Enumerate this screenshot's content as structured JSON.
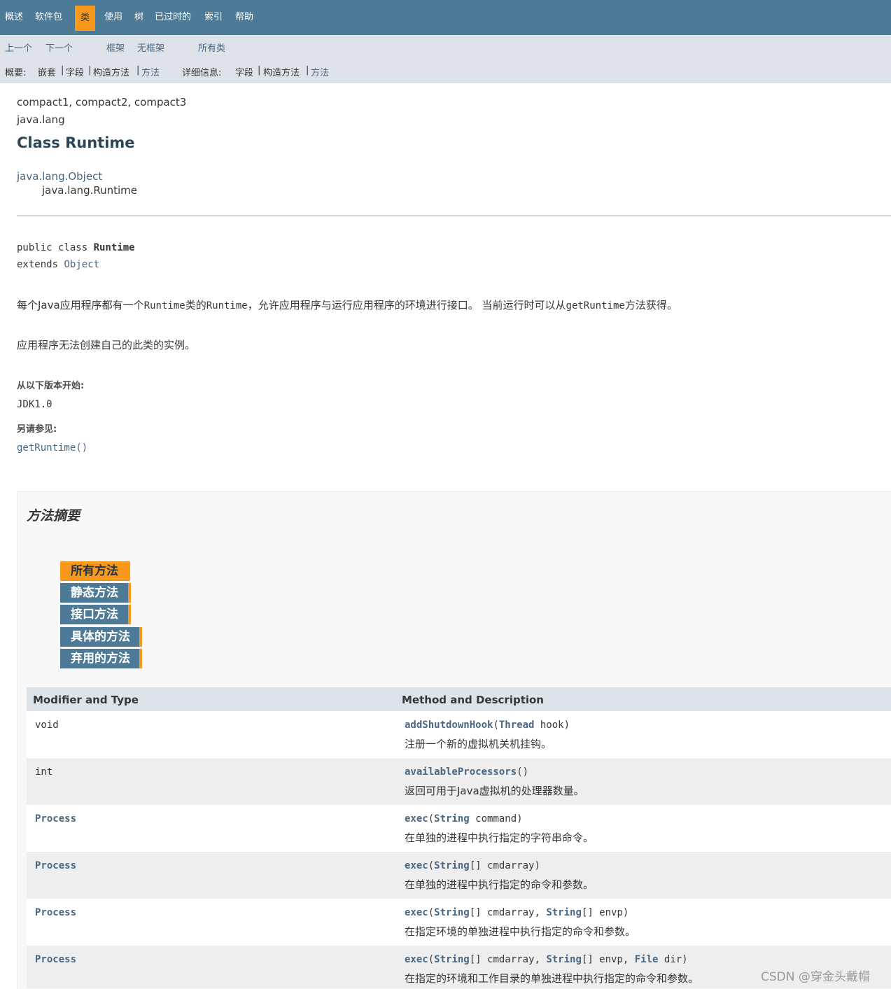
{
  "topnav": {
    "overview": "概述",
    "package": "软件包",
    "class": "类",
    "use": "使用",
    "tree": "树",
    "deprecated": "已过时的",
    "index": "索引",
    "help": "帮助"
  },
  "subnav": {
    "prev": "上一个",
    "next": "下一个",
    "frames": "框架",
    "no_frames": "无框架",
    "all_classes": "所有类",
    "summary_label": "概要:",
    "summary_nested": "嵌套",
    "summary_field": "字段",
    "summary_constr": "构造方法",
    "summary_method": "方法",
    "detail_label": "详细信息:",
    "detail_field": "字段",
    "detail_constr": "构造方法",
    "detail_method": "方法",
    "sep": "|"
  },
  "header": {
    "profiles": "compact1, compact2, compact3",
    "package": "java.lang",
    "title": "Class Runtime"
  },
  "inheritance": {
    "parent": "java.lang.Object",
    "child": "java.lang.Runtime"
  },
  "signature": {
    "line1_prefix": "public class ",
    "line1_name": "Runtime",
    "line2_prefix": "extends ",
    "line2_link": "Object"
  },
  "description": {
    "p1_a": "每个Java应用程序都有一个",
    "p1_code1": "Runtime",
    "p1_b": "类的",
    "p1_code2": "Runtime",
    "p1_c": "，允许应用程序与运行应用程序的环境进行接口。 当前运行时可以从",
    "p1_code3": "getRuntime",
    "p1_d": "方法获得。",
    "p2": "应用程序无法创建自己的此类的实例。"
  },
  "since": {
    "label": "从以下版本开始:",
    "value": "JDK1.0"
  },
  "see_also": {
    "label": "另请参见:",
    "value": "getRuntime()"
  },
  "method_summary": {
    "title": "方法摘要",
    "tabs": [
      "所有方法",
      "静态方法",
      "接口方法",
      "具体的方法",
      "弃用的方法"
    ],
    "col_type": "Modifier and Type",
    "col_method": "Method and Description",
    "rows": [
      {
        "type": "void",
        "name": "addShutdownHook",
        "open": "(",
        "p1_type": "Thread",
        "p1_rest": " hook)",
        "desc": "注册一个新的虚拟机关机挂钩。"
      },
      {
        "type": "int",
        "name": "availableProcessors",
        "open": "()",
        "desc": "返回可用于Java虚拟机的处理器数量。"
      },
      {
        "type": "Process",
        "name": "exec",
        "open": "(",
        "p1_type": "String",
        "p1_rest": " command)",
        "desc": "在单独的进程中执行指定的字符串命令。"
      },
      {
        "type": "Process",
        "name": "exec",
        "open": "(",
        "p1_type": "String",
        "p1_rest": "[] cmdarray)",
        "desc": "在单独的进程中执行指定的命令和参数。"
      },
      {
        "type": "Process",
        "name": "exec",
        "open": "(",
        "p1_type": "String",
        "p1_rest": "[] cmdarray, ",
        "p2_type": "String",
        "p2_rest": "[] envp)",
        "desc": "在指定环境的单独进程中执行指定的命令和参数。"
      },
      {
        "type": "Process",
        "name": "exec",
        "open": "(",
        "p1_type": "String",
        "p1_rest": "[] cmdarray, ",
        "p2_type": "String",
        "p2_rest": "[] envp, ",
        "p3_type": "File",
        "p3_rest": " dir)",
        "desc": "在指定的环境和工作目录的单独进程中执行指定的命令和参数。"
      }
    ]
  },
  "watermark": "CSDN @穿金头戴帽",
  "colors": {
    "nav_bg": "#4d7a97",
    "subnav_bg": "#dee3e9",
    "accent": "#f8981d",
    "link": "#4a6782",
    "alt_row": "#eeeeef"
  }
}
